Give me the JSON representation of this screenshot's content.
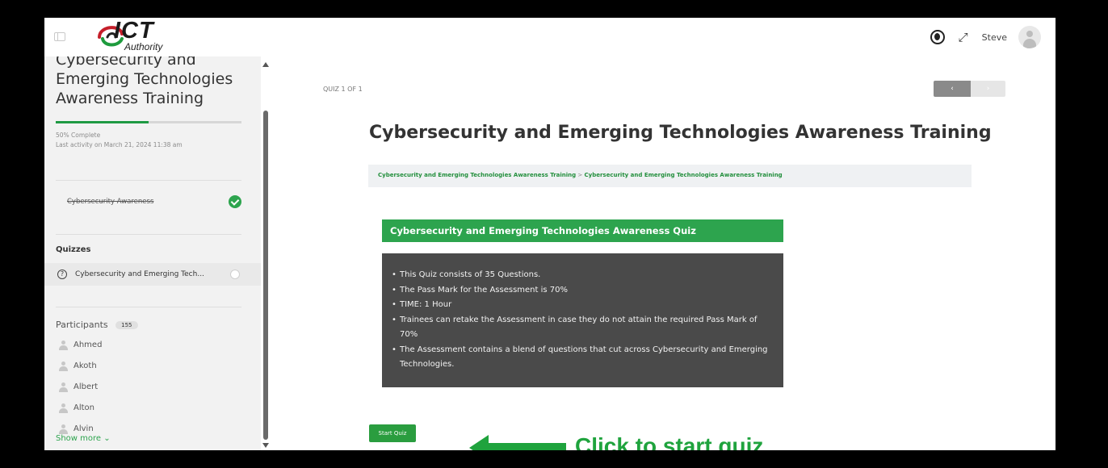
{
  "header": {
    "logo_text": "ICT",
    "logo_subtext": "Authority",
    "user_name": "Steve",
    "icons": [
      "sidebar-toggle-icon",
      "dark-mode-icon",
      "expand-icon",
      "avatar-icon"
    ]
  },
  "sidebar": {
    "course_title": "Cybersecurity and Emerging Technologies Awareness Training",
    "progress_percent": 50,
    "progress_text": "50% Complete",
    "last_activity": "Last activity on March 21, 2024 11:38 am",
    "lessons": [
      {
        "title": "Cybersecurity Awareness",
        "completed": true
      }
    ],
    "quizzes_heading": "Quizzes",
    "quizzes": [
      {
        "title": "Cybersecurity and Emerging Tech..."
      }
    ],
    "participants_heading": "Participants",
    "participants_count": "155",
    "participants": [
      "Ahmed",
      "Akoth",
      "Albert",
      "Alton",
      "Alvin"
    ],
    "show_more": "Show more ⌄"
  },
  "main": {
    "quiz_counter": "QUIZ 1 OF 1",
    "nav_prev": "‹",
    "nav_next": "›",
    "title": "Cybersecurity and Emerging Technologies Awareness Training",
    "breadcrumb": [
      "Cybersecurity and Emerging Technologies Awareness Training",
      "Cybersecurity and Emerging Technologies Awareness Training"
    ],
    "breadcrumb_separator": " > ",
    "quiz_heading": "Cybersecurity and Emerging Technologies Awareness Quiz",
    "rules": [
      "This Quiz consists of 35 Questions.",
      "The Pass Mark for the Assessment is 70%",
      "TIME: 1 Hour",
      "Trainees can retake the Assessment in case they do not attain the required Pass Mark of 70%",
      "The Assessment contains a blend of questions that cut across Cybersecurity and Emerging Technologies."
    ],
    "start_button": "Start Quiz"
  },
  "annotation": {
    "text": "Click to start quiz"
  },
  "colors": {
    "accent_green": "#2da44e",
    "breadcrumb_green": "#238f3d",
    "rules_box": "#4a4a4a",
    "sidebar_bg": "#f2f2f2"
  }
}
